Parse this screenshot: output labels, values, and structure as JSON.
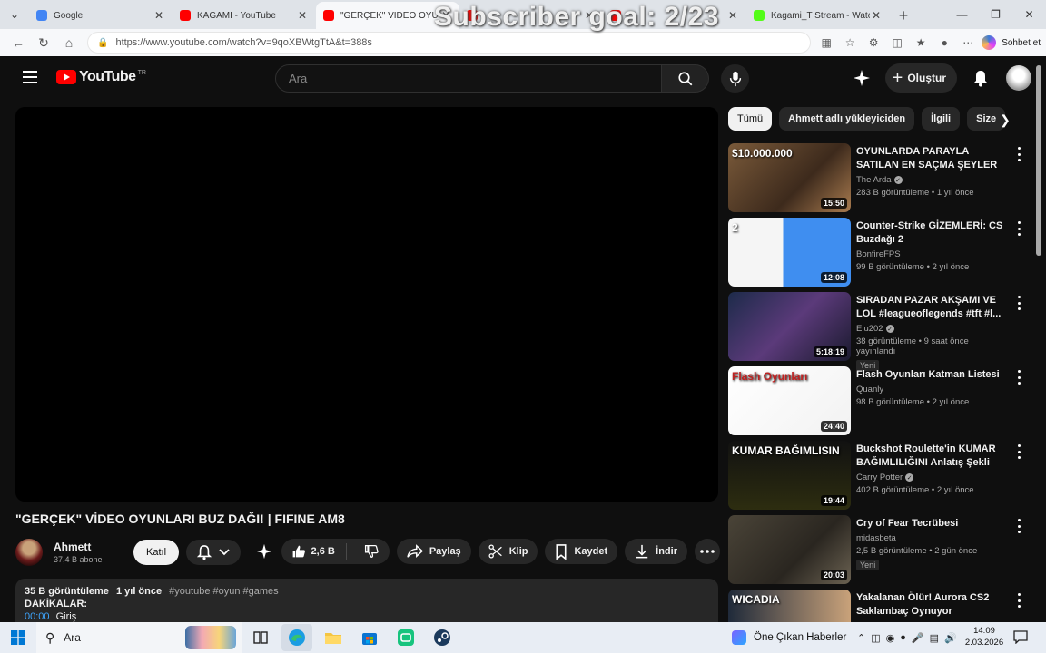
{
  "browser": {
    "tabs": [
      {
        "title": "Google",
        "favicon_color": "#4285f4",
        "active": false
      },
      {
        "title": "KAGAMI - YouTube",
        "favicon_color": "#ff0000",
        "active": false
      },
      {
        "title": "\"GERÇEK\" VİDEO OYUNLARI",
        "favicon_color": "#ff0000",
        "active": true
      },
      {
        "title": "",
        "favicon_color": "#ff0000",
        "active": false
      },
      {
        "title": "",
        "favicon_color": "#ff0000",
        "active": false
      },
      {
        "title": "Kagami_T Stream - Watch",
        "favicon_color": "#53fc18",
        "active": false
      }
    ],
    "url": "https://www.youtube.com/watch?v=9qoXBWtgTtA&t=388s",
    "copilot_label": "Sohbet et"
  },
  "overlay": {
    "text": "Subscriber goal: 2/23"
  },
  "youtube": {
    "logo_text": "YouTube",
    "country": "TR",
    "search_placeholder": "Ara",
    "create_label": "Oluştur",
    "video": {
      "title": "\"GERÇEK\" VİDEO OYUNLARI BUZ DAĞI! | FIFINE AM8",
      "channel": "Ahmett",
      "subscribers": "37,4 B abone",
      "join_label": "Katıl",
      "likes": "2,6 B",
      "share_label": "Paylaş",
      "clip_label": "Klip",
      "save_label": "Kaydet",
      "download_label": "İndir"
    },
    "description": {
      "views": "35 B görüntüleme",
      "age": "1 yıl önce",
      "tags": "#youtube #oyun #games",
      "line2": "DAKİKALAR:",
      "line3_ts": "00:00",
      "line3_text": "Giriş"
    },
    "chips": [
      "Tümü",
      "Ahmett adlı yükleyiciden",
      "İlgili",
      "Size"
    ],
    "recommendations": [
      {
        "title": "OYUNLARDA PARAYLA SATILAN EN SAÇMA ŞEYLER ...",
        "channel": "The Arda",
        "verified": true,
        "meta": "283 B görüntüleme • 1 yıl önce",
        "duration": "15:50",
        "badge": "",
        "thumb_text": "$10.000.000",
        "thumb_bg": "linear-gradient(135deg,#7a5a3a,#3d2a1c 60%,#a97b4f)"
      },
      {
        "title": "Counter-Strike GİZEMLERİ: CS Buzdağı 2",
        "channel": "BonfireFPS",
        "verified": false,
        "meta": "99 B görüntüleme • 2 yıl önce",
        "duration": "12:08",
        "badge": "",
        "thumb_text": "2",
        "thumb_bg": "linear-gradient(90deg,#f5f5f5 45%,#3f8ef0 45%)"
      },
      {
        "title": "SIRADAN PAZAR AKŞAMI VE LOL #leagueoflegends #tft #l...",
        "channel": "Elu202",
        "verified": true,
        "meta": "38 görüntüleme • 9 saat önce yayınlandı",
        "duration": "5:18:19",
        "badge": "Yeni",
        "thumb_text": "",
        "thumb_bg": "linear-gradient(135deg,#1d2b4a,#5b3a7a 50%,#1a1a2e)"
      },
      {
        "title": "Flash Oyunları Katman Listesi",
        "channel": "Quanly",
        "verified": false,
        "meta": "98 B görüntüleme • 2 yıl önce",
        "duration": "24:40",
        "badge": "",
        "thumb_text": "Flash Oyunları",
        "thumb_bg": "linear-gradient(135deg,#ffffff,#f2f2f2)"
      },
      {
        "title": "Buckshot Roulette'in KUMAR BAĞIMLILIĞINI Anlatış Şekli",
        "channel": "Carry Potter",
        "verified": true,
        "meta": "402 B görüntüleme • 2 yıl önce",
        "duration": "19:44",
        "badge": "",
        "thumb_text": "KUMAR BAĞIMLISIN",
        "thumb_bg": "linear-gradient(180deg,#111,#2d2d10)"
      },
      {
        "title": "Cry of Fear Tecrübesi",
        "channel": "midasbeta",
        "verified": false,
        "meta": "2,5 B görüntüleme • 2 gün önce",
        "duration": "20:03",
        "badge": "Yeni",
        "thumb_text": "",
        "thumb_bg": "linear-gradient(135deg,#4a4438,#2a2620 60%,#6b6252)"
      },
      {
        "title": "Yakalanan Ölür! Aurora CS2 Saklambaç Oynuyor",
        "channel": "",
        "verified": false,
        "meta": "",
        "duration": "",
        "badge": "",
        "thumb_text": "WICADIA",
        "thumb_bg": "linear-gradient(90deg,#1f2a3a,#c9a27a)"
      }
    ]
  },
  "taskbar": {
    "search_label": "Ara",
    "news_label": "Öne Çıkan Haberler",
    "time": "14:09",
    "date": "2.03.2026"
  }
}
